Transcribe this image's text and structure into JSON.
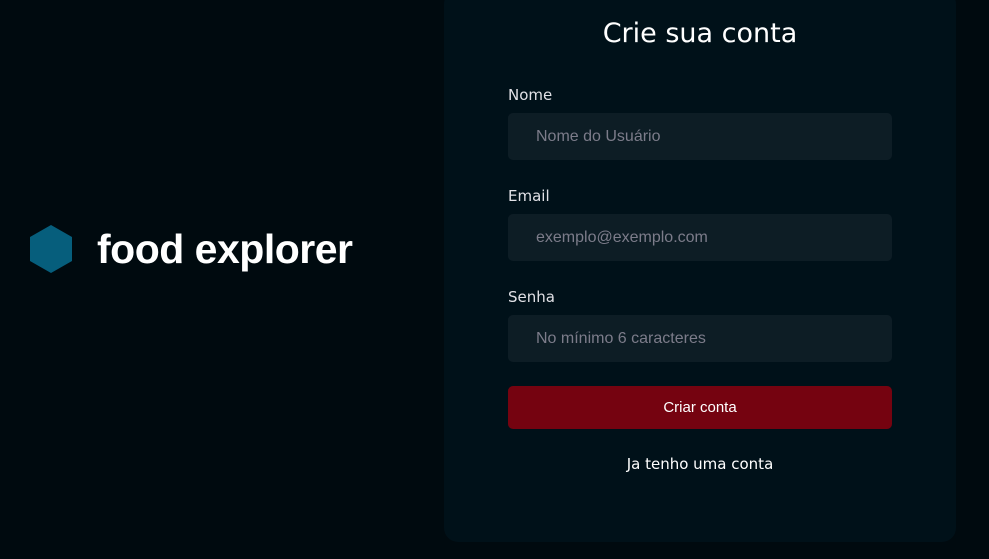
{
  "brand": {
    "name": "food explorer",
    "logo_icon": "hexagon-icon",
    "logo_color": "#065e7c"
  },
  "form": {
    "title": "Crie sua conta",
    "fields": [
      {
        "label": "Nome",
        "placeholder": "Nome do Usuário",
        "value": ""
      },
      {
        "label": "Email",
        "placeholder": "exemplo@exemplo.com",
        "value": ""
      },
      {
        "label": "Senha",
        "placeholder": "No mínimo 6 caracteres",
        "value": ""
      }
    ],
    "submit_label": "Criar conta",
    "login_link": "Ja tenho uma conta"
  },
  "colors": {
    "background": "#000a0f",
    "card": "#001119",
    "input": "#0d1d25",
    "button": "#750310",
    "placeholder": "#7c7c8a"
  }
}
